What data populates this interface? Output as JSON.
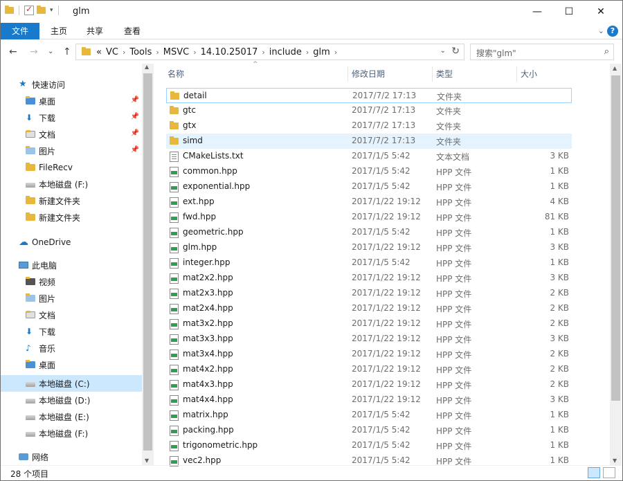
{
  "window": {
    "title": "glm",
    "minimize_icon": "—",
    "maximize_icon": "☐",
    "close_icon": "✕"
  },
  "ribbon": {
    "tabs": [
      "文件",
      "主页",
      "共享",
      "查看"
    ],
    "help": "?"
  },
  "nav": {
    "back": "←",
    "forward": "→",
    "recent": "⌄",
    "up": "↑",
    "breadcrumb": [
      "«",
      "VC",
      "Tools",
      "MSVC",
      "14.10.25017",
      "include",
      "glm"
    ],
    "search_placeholder": "搜索\"glm\""
  },
  "sidebar": {
    "items": [
      {
        "label": "快速访问",
        "icon": "star-icon"
      },
      {
        "label": "桌面",
        "icon": "desktop-folder-icon",
        "pinned": true
      },
      {
        "label": "下载",
        "icon": "download-icon",
        "pinned": true
      },
      {
        "label": "文档",
        "icon": "documents-icon",
        "pinned": true
      },
      {
        "label": "图片",
        "icon": "pictures-icon",
        "pinned": true
      },
      {
        "label": "FileRecv",
        "icon": "folder-icon"
      },
      {
        "label": "本地磁盘 (F:)",
        "icon": "drive-icon"
      },
      {
        "label": "新建文件夹",
        "icon": "folder-icon"
      },
      {
        "label": "新建文件夹",
        "icon": "folder-icon"
      },
      {
        "label": "OneDrive",
        "icon": "cloud-icon"
      },
      {
        "label": "此电脑",
        "icon": "computer-icon"
      },
      {
        "label": "视频",
        "icon": "videos-icon"
      },
      {
        "label": "图片",
        "icon": "pictures-icon"
      },
      {
        "label": "文档",
        "icon": "documents-icon"
      },
      {
        "label": "下载",
        "icon": "download-icon"
      },
      {
        "label": "音乐",
        "icon": "music-icon"
      },
      {
        "label": "桌面",
        "icon": "desktop-folder-icon"
      },
      {
        "label": "本地磁盘 (C:)",
        "icon": "drive-icon",
        "selected": true
      },
      {
        "label": "本地磁盘 (D:)",
        "icon": "drive-icon"
      },
      {
        "label": "本地磁盘 (E:)",
        "icon": "drive-icon"
      },
      {
        "label": "本地磁盘 (F:)",
        "icon": "drive-icon"
      },
      {
        "label": "网络",
        "icon": "network-icon"
      }
    ]
  },
  "columns": {
    "name": "名称",
    "date": "修改日期",
    "type": "类型",
    "size": "大小"
  },
  "files": [
    {
      "name": "detail",
      "date": "2017/7/2 17:13",
      "type": "文件夹",
      "size": "",
      "kind": "folder"
    },
    {
      "name": "gtc",
      "date": "2017/7/2 17:13",
      "type": "文件夹",
      "size": "",
      "kind": "folder"
    },
    {
      "name": "gtx",
      "date": "2017/7/2 17:13",
      "type": "文件夹",
      "size": "",
      "kind": "folder"
    },
    {
      "name": "simd",
      "date": "2017/7/2 17:13",
      "type": "文件夹",
      "size": "",
      "kind": "folder"
    },
    {
      "name": "CMakeLists.txt",
      "date": "2017/1/5 5:42",
      "type": "文本文档",
      "size": "3 KB",
      "kind": "txt"
    },
    {
      "name": "common.hpp",
      "date": "2017/1/5 5:42",
      "type": "HPP 文件",
      "size": "1 KB",
      "kind": "hpp"
    },
    {
      "name": "exponential.hpp",
      "date": "2017/1/5 5:42",
      "type": "HPP 文件",
      "size": "1 KB",
      "kind": "hpp"
    },
    {
      "name": "ext.hpp",
      "date": "2017/1/22 19:12",
      "type": "HPP 文件",
      "size": "4 KB",
      "kind": "hpp"
    },
    {
      "name": "fwd.hpp",
      "date": "2017/1/22 19:12",
      "type": "HPP 文件",
      "size": "81 KB",
      "kind": "hpp"
    },
    {
      "name": "geometric.hpp",
      "date": "2017/1/5 5:42",
      "type": "HPP 文件",
      "size": "1 KB",
      "kind": "hpp"
    },
    {
      "name": "glm.hpp",
      "date": "2017/1/22 19:12",
      "type": "HPP 文件",
      "size": "3 KB",
      "kind": "hpp"
    },
    {
      "name": "integer.hpp",
      "date": "2017/1/5 5:42",
      "type": "HPP 文件",
      "size": "1 KB",
      "kind": "hpp"
    },
    {
      "name": "mat2x2.hpp",
      "date": "2017/1/22 19:12",
      "type": "HPP 文件",
      "size": "3 KB",
      "kind": "hpp"
    },
    {
      "name": "mat2x3.hpp",
      "date": "2017/1/22 19:12",
      "type": "HPP 文件",
      "size": "2 KB",
      "kind": "hpp"
    },
    {
      "name": "mat2x4.hpp",
      "date": "2017/1/22 19:12",
      "type": "HPP 文件",
      "size": "2 KB",
      "kind": "hpp"
    },
    {
      "name": "mat3x2.hpp",
      "date": "2017/1/22 19:12",
      "type": "HPP 文件",
      "size": "2 KB",
      "kind": "hpp"
    },
    {
      "name": "mat3x3.hpp",
      "date": "2017/1/22 19:12",
      "type": "HPP 文件",
      "size": "3 KB",
      "kind": "hpp"
    },
    {
      "name": "mat3x4.hpp",
      "date": "2017/1/22 19:12",
      "type": "HPP 文件",
      "size": "2 KB",
      "kind": "hpp"
    },
    {
      "name": "mat4x2.hpp",
      "date": "2017/1/22 19:12",
      "type": "HPP 文件",
      "size": "2 KB",
      "kind": "hpp"
    },
    {
      "name": "mat4x3.hpp",
      "date": "2017/1/22 19:12",
      "type": "HPP 文件",
      "size": "2 KB",
      "kind": "hpp"
    },
    {
      "name": "mat4x4.hpp",
      "date": "2017/1/22 19:12",
      "type": "HPP 文件",
      "size": "3 KB",
      "kind": "hpp"
    },
    {
      "name": "matrix.hpp",
      "date": "2017/1/5 5:42",
      "type": "HPP 文件",
      "size": "1 KB",
      "kind": "hpp"
    },
    {
      "name": "packing.hpp",
      "date": "2017/1/5 5:42",
      "type": "HPP 文件",
      "size": "1 KB",
      "kind": "hpp"
    },
    {
      "name": "trigonometric.hpp",
      "date": "2017/1/5 5:42",
      "type": "HPP 文件",
      "size": "1 KB",
      "kind": "hpp"
    },
    {
      "name": "vec2.hpp",
      "date": "2017/1/5 5:42",
      "type": "HPP 文件",
      "size": "1 KB",
      "kind": "hpp"
    }
  ],
  "status": {
    "count": "28 个项目"
  }
}
